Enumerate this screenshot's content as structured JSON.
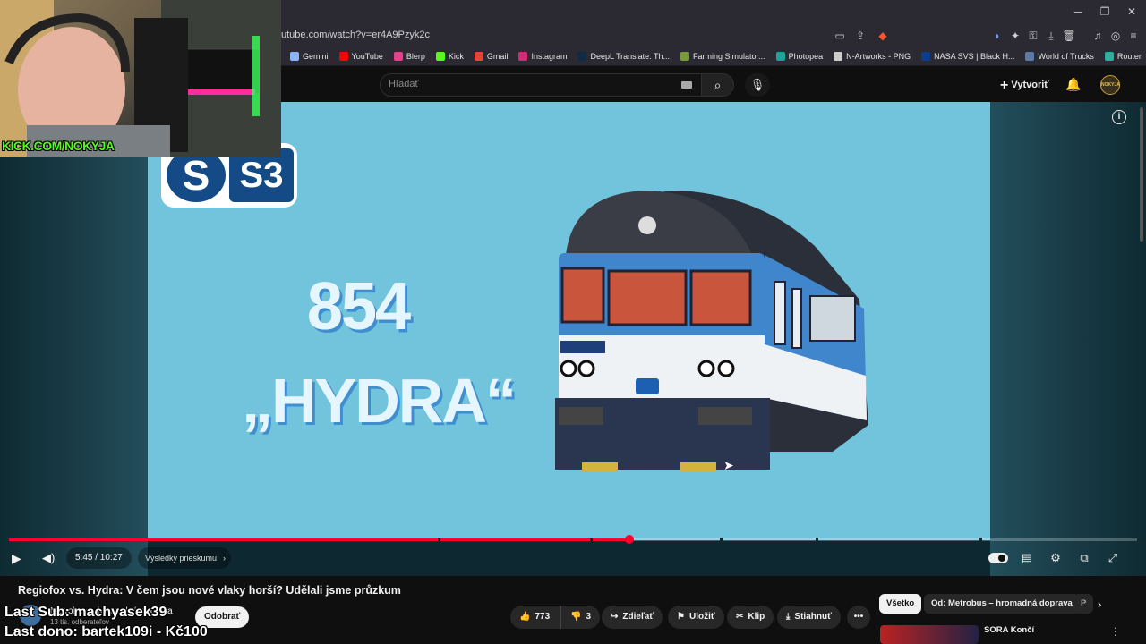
{
  "browser": {
    "url": "utube.com/watch?v=er4A9Pzyk2c",
    "window_controls": [
      "─",
      "❐",
      "✕"
    ],
    "bookmarks": [
      {
        "label": "Gemini",
        "color": "#8ab4f8"
      },
      {
        "label": "YouTube",
        "color": "#ff0000"
      },
      {
        "label": "Blerp",
        "color": "#e83e8c"
      },
      {
        "label": "Kick",
        "color": "#53fc18"
      },
      {
        "label": "Gmail",
        "color": "#ea4335"
      },
      {
        "label": "Instagram",
        "color": "#d62976"
      },
      {
        "label": "DeepL Translate: Th...",
        "color": "#0f2b46"
      },
      {
        "label": "Farming Simulator...",
        "color": "#7a9a3a"
      },
      {
        "label": "Photopea",
        "color": "#18a497"
      },
      {
        "label": "N-Artworks - PNG",
        "color": "#cccccc"
      },
      {
        "label": "NASA SVS | Black H...",
        "color": "#0b3d91"
      },
      {
        "label": "World of Trucks",
        "color": "#5b7aa6"
      },
      {
        "label": "Router",
        "color": "#2bb0a0"
      }
    ]
  },
  "youtube_header": {
    "search_placeholder": "Hľadať",
    "create_label": "Vytvoriť",
    "avatar_text": "NOKYJA"
  },
  "video_frame": {
    "logo_s": "S",
    "logo_s3": "S3",
    "big_number": "854",
    "big_name": "„HYDRA“"
  },
  "webcam": {
    "overlay": "KICK.COM/NOKYJA"
  },
  "player": {
    "time": "5:45 / 10:27",
    "progress_fraction": 0.55,
    "survey_label": "Výsledky prieskumu",
    "chapter_marks": [
      0.38,
      0.515,
      0.63,
      0.715,
      0.86
    ]
  },
  "video": {
    "title": "Regiofox vs. Hydra: V čem jsou nové vlaky horší? Udělali jsme průzkum",
    "channel": "Metrobus – hromadná doprava",
    "subscribers": "13 tis. odberateľov",
    "unsubscribe_label": "Odobrať",
    "likes": "773",
    "dislikes": "3",
    "share_label": "Zdieľať",
    "save_label": "Uložiť",
    "clip_label": "Klip",
    "download_label": "Stiahnuť"
  },
  "stream_overlay": {
    "last_sub": "Last Sub: machyasek39",
    "last_dono": "Last dono: bartek109i - Kč100"
  },
  "recommendations": {
    "chips": [
      "Všetko",
      "Od: Metrobus – hromadná doprava",
      "P"
    ],
    "first_title": "SORA Končí"
  }
}
